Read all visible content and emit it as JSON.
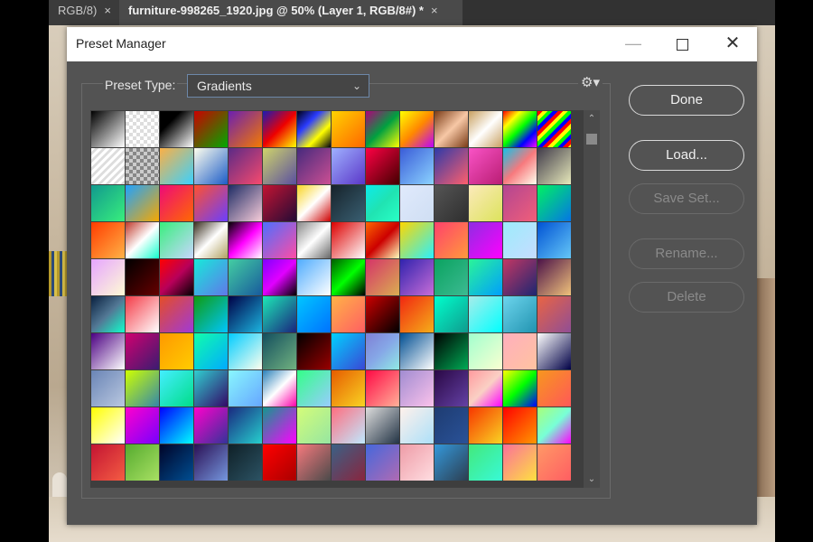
{
  "document_tabs": [
    {
      "label": "RGB/8)",
      "close": "×"
    },
    {
      "label": "furniture-998265_1920.jpg @ 50% (Layer 1, RGB/8#) *",
      "close": "×"
    }
  ],
  "dialog": {
    "title": "Preset Manager",
    "window_controls": {
      "minimize": "—",
      "close": "✕"
    },
    "preset_type_label": "Preset Type:",
    "preset_type_value": "Gradients",
    "gear_icon": "⚙▾",
    "buttons": {
      "done": "Done",
      "load": "Load...",
      "save_set": "Save Set...",
      "rename": "Rename...",
      "delete": "Delete"
    }
  },
  "gradients": [
    "linear-gradient(135deg,#000,#fff)",
    "repeating-conic-gradient(#ddd 0 25%,#fff 0 50%) 0 0/8px 8px",
    "linear-gradient(135deg,#000 30%,#fff)",
    "linear-gradient(135deg,#c00,#0a0)",
    "linear-gradient(135deg,#6b1fb1,#f57a00)",
    "linear-gradient(135deg,#1a1ab5,#e00,#ff0)",
    "linear-gradient(135deg,#001,#2b3cff,#ff0,#001)",
    "linear-gradient(135deg,#ffd300,#f60)",
    "linear-gradient(135deg,#b0007a,#00a040,#ff0)",
    "linear-gradient(135deg,#ff0,#f80,#b0f)",
    "linear-gradient(135deg,#7a3b16,#f7c8a6,#7a3b16)",
    "linear-gradient(135deg,#c8a060,#fff,#c8a060)",
    "linear-gradient(135deg,#f00,#ff0,#0f0,#00f,#f0f)",
    "repeating-linear-gradient(135deg,#f00 0 4px,#ff0 4px 8px,#0f0 8px 12px,#00f 12px 16px)",
    "repeating-linear-gradient(135deg,#fff 0 3px,#ddd 3px 6px)",
    "repeating-conic-gradient(#888 0 25%,#ccc 0 50%) 0 0/8px 8px",
    "linear-gradient(135deg,#fcb045,#3ad1ff)",
    "linear-gradient(135deg,#ffe,#1b5cc8)",
    "linear-gradient(135deg,#5b2a86,#f74a6e)",
    "linear-gradient(135deg,#cfd46a,#5a4fa0)",
    "linear-gradient(135deg,#462a7d,#cc4f93)",
    "linear-gradient(135deg,#9fb1ff,#5a36c8)",
    "linear-gradient(135deg,#f04,#400)",
    "linear-gradient(135deg,#3a5cd8,#8bd3ff)",
    "linear-gradient(135deg,#2d3aa8,#ff5f6d)",
    "linear-gradient(135deg,#f953c6,#b91d73)",
    "linear-gradient(135deg,#12c2e9,#f7797d,#ffe)",
    "linear-gradient(135deg,#403b4a,#e7e9bb)",
    "linear-gradient(135deg,#11998e,#38ef7d)",
    "linear-gradient(135deg,#1fa2ff,#f7a800)",
    "linear-gradient(135deg,#ee0979,#ff6a00)",
    "linear-gradient(135deg,#ff512f,#6a3eff)",
    "linear-gradient(135deg,#1d2b64,#f8cdda)",
    "linear-gradient(135deg,#c31432,#240b36)",
    "linear-gradient(135deg,#f9d423,#fff,#c00)",
    "linear-gradient(135deg,#16222a,#3a6073)",
    "linear-gradient(135deg,#0cebeb,#20e3b2,#29ffc6)",
    "linear-gradient(135deg,#e0eafc,#cfdef3)",
    "linear-gradient(135deg,#555,#2e2e2e)",
    "linear-gradient(135deg,#fceabb,#dce35b)",
    "linear-gradient(135deg,#b24592,#f15f79)",
    "linear-gradient(135deg,#00f260,#0575e6)",
    "linear-gradient(135deg,#ff3c00,#ffb347)",
    "linear-gradient(135deg,#c0392b,#fff,#1fc)",
    "linear-gradient(135deg,#38ef7d,#c9d6ff)",
    "linear-gradient(135deg,#3a2f1f,#fff,#b0a060)",
    "linear-gradient(135deg,#000,#f0f,#fff)",
    "linear-gradient(135deg,#4c6fff,#ff4ca5)",
    "linear-gradient(135deg,#888,#fff,#666)",
    "linear-gradient(135deg,#d00,#fff)",
    "linear-gradient(135deg,#ff6600,#c00,#ffb)",
    "linear-gradient(135deg,#ffd700,#2af0ff)",
    "linear-gradient(135deg,#ff416c,#ff9a3c)",
    "linear-gradient(135deg,#8e2de2,#f0f)",
    "linear-gradient(135deg,#9cecfb,#c6dcff)",
    "linear-gradient(135deg,#0052d4,#65c7f7)",
    "linear-gradient(135deg,#e6a5ff,#fffbd5)",
    "linear-gradient(135deg,#000,#600)",
    "linear-gradient(135deg,#f00,#b8005a,#000)",
    "linear-gradient(135deg,#17ead9,#6078ea)",
    "linear-gradient(135deg,#43cea2,#185a9d)",
    "linear-gradient(135deg,#7f00ff,#e100ff,#000)",
    "linear-gradient(135deg,#4facfe,#fff)",
    "linear-gradient(135deg,#005c00,#0f0,#000)",
    "linear-gradient(135deg,#d53369,#daae51)",
    "linear-gradient(135deg,#3023ae,#c86dd7)",
    "linear-gradient(135deg,#0ba360,#3cba92)",
    "linear-gradient(135deg,#2af598,#009efd)",
    "linear-gradient(135deg,#c33764,#1d2671)",
    "linear-gradient(135deg,#4b1248,#f0c27b)",
    "linear-gradient(135deg,#09203f,#537895,#1fc)",
    "linear-gradient(135deg,#f43b47,#fff)",
    "linear-gradient(135deg,#e44d26,#a03ad8)",
    "linear-gradient(135deg,#0f9b0f,#00c6ff)",
    "linear-gradient(135deg,#000046,#1cb5e0)",
    "linear-gradient(135deg,#1de9b6,#1a237e)",
    "linear-gradient(135deg,#00c6ff,#0072ff)",
    "linear-gradient(135deg,#ffb347,#ff5e62)",
    "linear-gradient(135deg,#c00,#000)",
    "linear-gradient(135deg,#f12711,#f5af19)",
    "linear-gradient(135deg,#0fc,#0f9b8e)",
    "linear-gradient(135deg,#a8edea,#0ff)",
    "linear-gradient(135deg,#6dd5ed,#2193b0)",
    "linear-gradient(135deg,#e96443,#904e95)",
    "linear-gradient(135deg,#4b0082,#fff)",
    "linear-gradient(135deg,#d1006f,#3a1c71)",
    "linear-gradient(135deg,#ff9900,#ffcc00)",
    "linear-gradient(135deg,#1fa,#0af)",
    "linear-gradient(135deg,#0cf,#ffe)",
    "linear-gradient(135deg,#134e5e,#71b280)",
    "linear-gradient(135deg,#000,#900)",
    "linear-gradient(135deg,#00d2ff,#3a47d5)",
    "linear-gradient(135deg,#7f7fd5,#86a8e7,#91eae4)",
    "linear-gradient(135deg,#004e92,#fff)",
    "linear-gradient(135deg,#000,#0a5)",
    "linear-gradient(135deg,#a1ffce,#faffd1)",
    "linear-gradient(135deg,#ffafbd,#ffc3a0)",
    "linear-gradient(135deg,#fff,#000046)",
    "linear-gradient(135deg,#6a85b6,#bac8e0)",
    "linear-gradient(135deg,#cfff00,#38a)",
    "linear-gradient(135deg,#4ef,#0d8)",
    "linear-gradient(135deg,#30cfd0,#330867)",
    "linear-gradient(135deg,#89f7fe,#66a6ff)",
    "linear-gradient(135deg,#2980b9,#ffffff,#ff00aa)",
    "linear-gradient(135deg,#3f8,#9cf)",
    "linear-gradient(135deg,#e65c00,#f9d423)",
    "linear-gradient(135deg,#ff0844,#ffb199)",
    "linear-gradient(135deg,#a18cd1,#fbc2eb)",
    "linear-gradient(135deg,#2a0845,#6441a5)",
    "linear-gradient(135deg,#ff9a9e,#fad0c4,#f0f)",
    "linear-gradient(135deg,#ff0,#0f0,#00f)",
    "linear-gradient(135deg,#f7971e,#ff5858)",
    "linear-gradient(135deg,#ff0,#fff)",
    "linear-gradient(135deg,#f0c,#70f)",
    "linear-gradient(135deg,#00f,#0ff)",
    "linear-gradient(135deg,#ff00cc,#333399)",
    "linear-gradient(135deg,#1a2980,#26d0ce)",
    "linear-gradient(135deg,#11998e,#f0f)",
    "linear-gradient(135deg,#d4fc79,#96e6a1)",
    "linear-gradient(135deg,#ff6e7f,#bfe9ff)",
    "linear-gradient(135deg,#ddd,#234)",
    "linear-gradient(135deg,#fff1eb,#ace0f9)",
    "linear-gradient(135deg,#1e3c72,#2a5298)",
    "linear-gradient(135deg,#f83600,#f9d423)",
    "linear-gradient(135deg,#f00,#f90)",
    "linear-gradient(135deg,#a8ff78,#78ffd6,#f0f)",
    "linear-gradient(135deg,#c31432,#f45c43)",
    "linear-gradient(135deg,#56ab2f,#a8e063)",
    "linear-gradient(135deg,#000428,#004e92)",
    "linear-gradient(135deg,#2b1055,#7597de)",
    "linear-gradient(135deg,#0f2027,#2c5364)",
    "linear-gradient(135deg,#f00,#a00)",
    "linear-gradient(135deg,#f7797d,#4a4a4a)",
    "linear-gradient(135deg,#3a6186,#89253e)",
    "linear-gradient(135deg,#4568dc,#b06ab3)",
    "linear-gradient(135deg,#ee9ca7,#ffdde1)",
    "linear-gradient(135deg,#3498db,#2c3e50)",
    "linear-gradient(135deg,#43e97b,#38f9d7)",
    "linear-gradient(135deg,#fa709a,#fee140)",
    "linear-gradient(135deg,#ff9966,#ff5e62)"
  ]
}
